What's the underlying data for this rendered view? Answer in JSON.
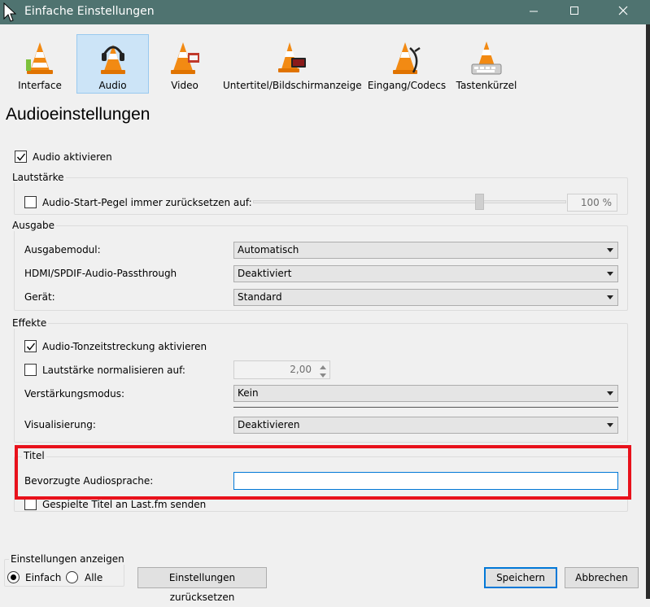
{
  "window": {
    "title": "Einfache Einstellungen"
  },
  "toolbar": {
    "items": [
      {
        "label": "Interface"
      },
      {
        "label": "Audio"
      },
      {
        "label": "Video"
      },
      {
        "label": "Untertitel/Bildschirmanzeige"
      },
      {
        "label": "Eingang/Codecs"
      },
      {
        "label": "Tastenkürzel"
      }
    ],
    "selected": "Audio"
  },
  "page": {
    "title": "Audioeinstellungen"
  },
  "audio_enable": {
    "label": "Audio aktivieren",
    "checked": true
  },
  "volume": {
    "group_label": "Lautstärke",
    "reset_label": "Audio-Start-Pegel immer zurücksetzen auf:",
    "reset_checked": false,
    "level_fraction": 0.73,
    "value": "100 %"
  },
  "output": {
    "group_label": "Ausgabe",
    "module_label": "Ausgabemodul:",
    "module_value": "Automatisch",
    "passthrough_label": "HDMI/SPDIF-Audio-Passthrough",
    "passthrough_value": "Deaktiviert",
    "device_label": "Gerät:",
    "device_value": "Standard"
  },
  "effects": {
    "group_label": "Effekte",
    "stretch_label": "Audio-Tonzeitstreckung aktivieren",
    "stretch_checked": true,
    "normalize_label": "Lautstärke normalisieren auf:",
    "normalize_checked": false,
    "normalize_value": "2,00",
    "gain_label": "Verstärkungsmodus:",
    "gain_value": "Kein",
    "visual_label": "Visualisierung:",
    "visual_value": "Deaktivieren"
  },
  "tracks": {
    "group_label": "Titel",
    "language_label": "Bevorzugte Audiosprache:",
    "language_value": "",
    "lastfm_label": "Gespielte Titel an Last.fm senden",
    "lastfm_checked": false
  },
  "show_settings": {
    "group_label": "Einstellungen anzeigen",
    "simple_label": "Einfach",
    "all_label": "Alle",
    "selected": "Einfach"
  },
  "buttons": {
    "reset": "Einstellungen zurücksetzen",
    "save": "Speichern",
    "cancel": "Abbrechen"
  },
  "colors": {
    "titlebar": "#4f7370",
    "highlight": "#e8111b",
    "selected_tab": "#cce4f7",
    "focus": "#0078d7"
  }
}
